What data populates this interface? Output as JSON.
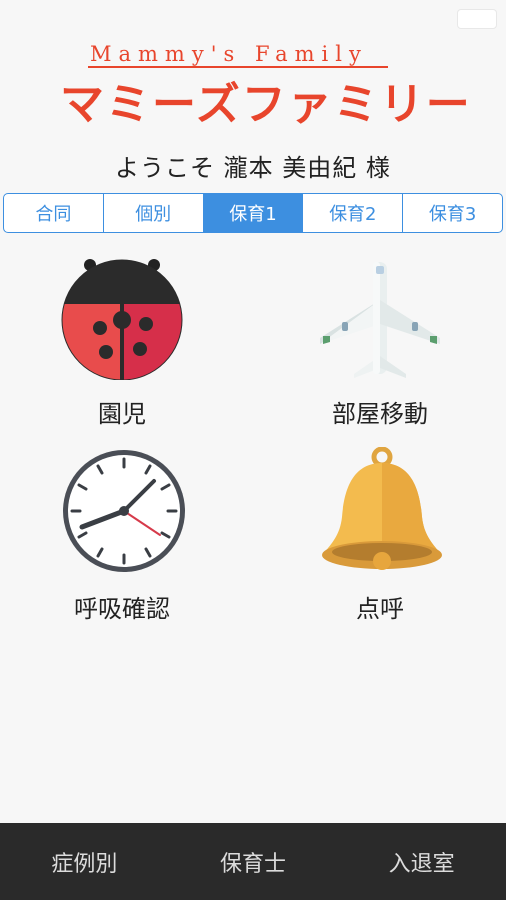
{
  "logo": {
    "english": "Mammy's Family",
    "japanese": "マミーズファミリー"
  },
  "welcome": "ようこそ 瀧本 美由紀 様",
  "tabs": [
    {
      "label": "合同",
      "active": false
    },
    {
      "label": "個別",
      "active": false
    },
    {
      "label": "保育1",
      "active": true
    },
    {
      "label": "保育2",
      "active": false
    },
    {
      "label": "保育3",
      "active": false
    }
  ],
  "tiles": [
    {
      "label": "園児",
      "icon": "ladybug-icon"
    },
    {
      "label": "部屋移動",
      "icon": "airplane-icon"
    },
    {
      "label": "呼吸確認",
      "icon": "clock-icon"
    },
    {
      "label": "点呼",
      "icon": "bell-icon"
    }
  ],
  "bottom_nav": [
    {
      "label": "症例別"
    },
    {
      "label": "保育士"
    },
    {
      "label": "入退室"
    }
  ],
  "colors": {
    "accent": "#3d8fe0",
    "brand": "#e8452c",
    "bottom_bar": "#2a2a2a"
  }
}
